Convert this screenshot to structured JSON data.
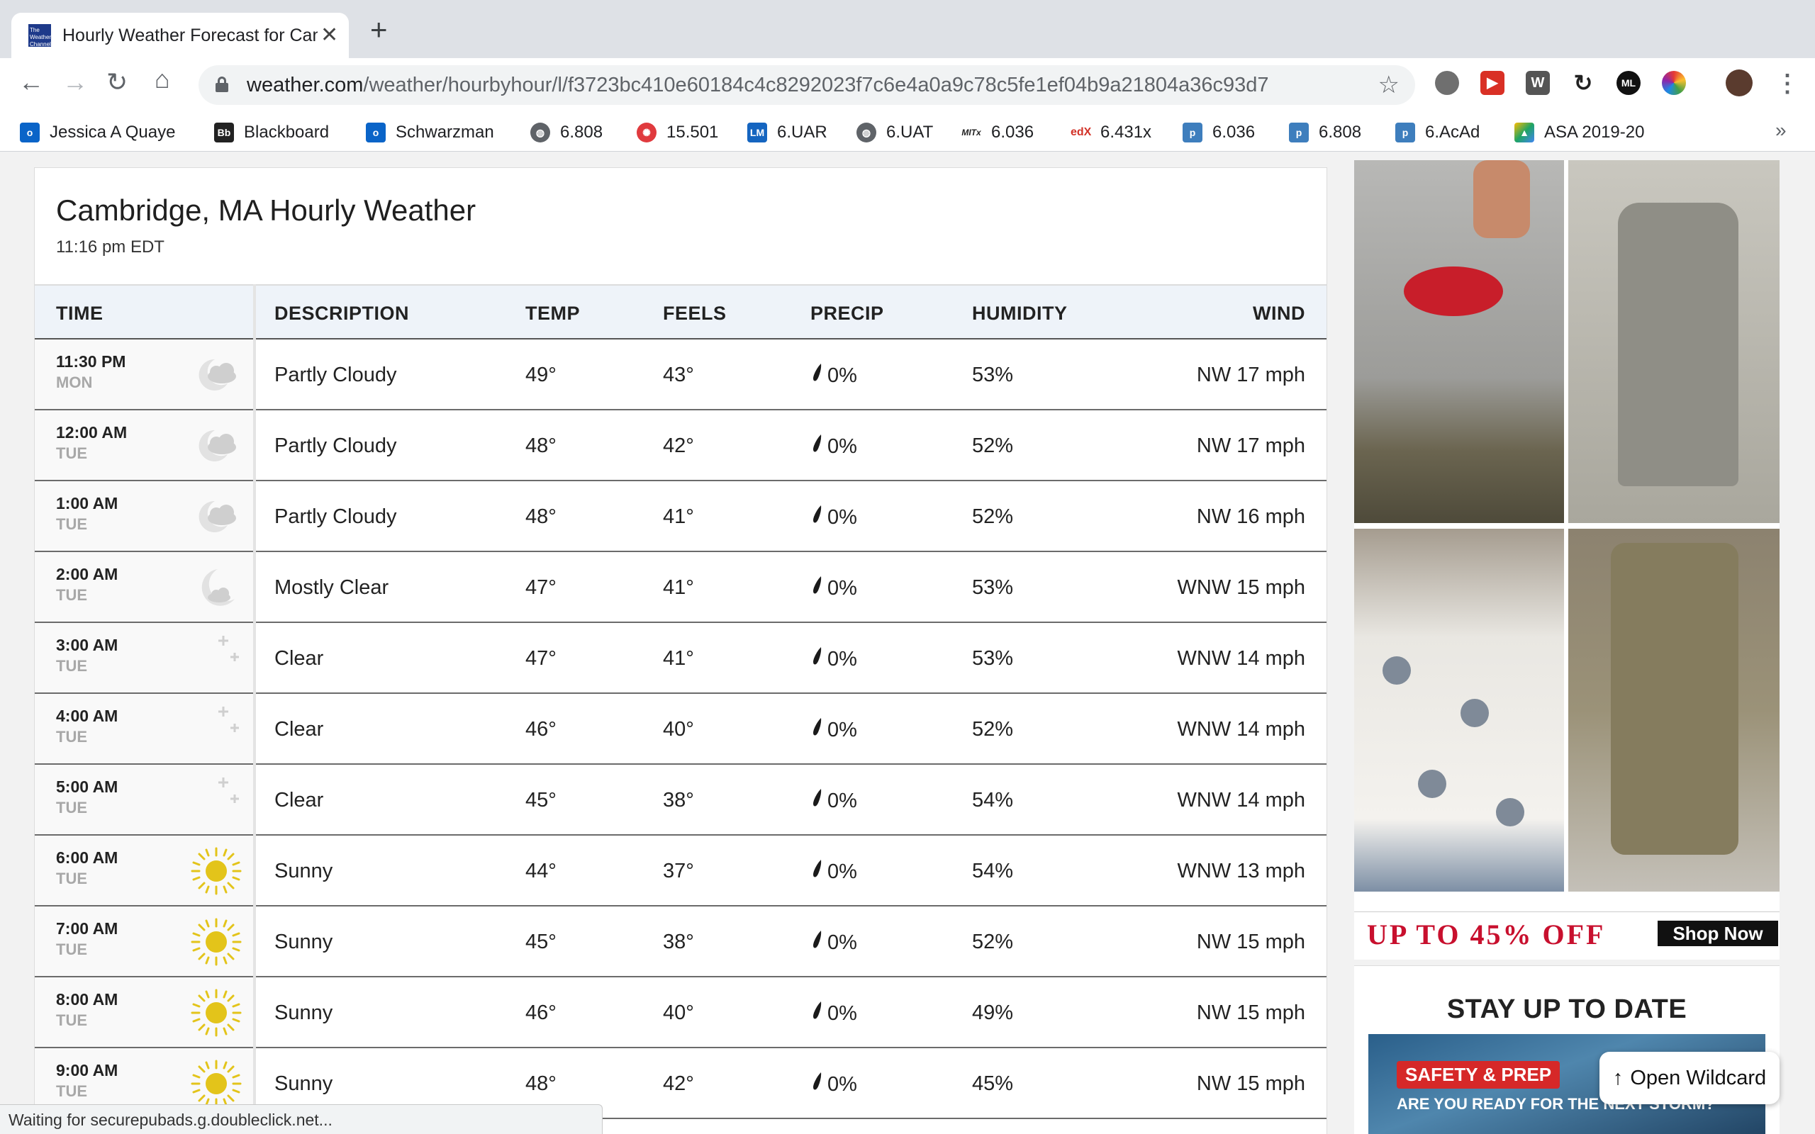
{
  "browser": {
    "tab_title": "Hourly Weather Forecast for Cambridge",
    "tab_favicon_text": "The Weather Channel",
    "url_host": "weather.com",
    "url_path": "/weather/hourbyhour/l/f3723bc410e60184c4c8292023f7c6e4a0a9c78c5fe1ef04b9a21804a36c93d7",
    "bookmarks": [
      {
        "label": "Jessica A Quaye",
        "icon": "outlook-icon",
        "color": "#0a64c8"
      },
      {
        "label": "Blackboard",
        "icon": "blackboard-icon",
        "color": "#222222"
      },
      {
        "label": "Schwarzman",
        "icon": "outlook-icon",
        "color": "#0a64c8"
      },
      {
        "label": "6.808",
        "icon": "globe-icon",
        "color": "#5f6368"
      },
      {
        "label": "15.501",
        "icon": "canvas-icon",
        "color": "#e03a3e"
      },
      {
        "label": "6.UAR",
        "icon": "lm-icon",
        "color": "#1565c0"
      },
      {
        "label": "6.UAT",
        "icon": "globe-icon",
        "color": "#5f6368"
      },
      {
        "label": "6.036",
        "icon": "mitx-icon",
        "color": "#333333"
      },
      {
        "label": "6.431x",
        "icon": "edx-icon",
        "color": "#d23228"
      },
      {
        "label": "6.036",
        "icon": "piazza-icon",
        "color": "#3e7ebd"
      },
      {
        "label": "6.808",
        "icon": "piazza-icon",
        "color": "#3e7ebd"
      },
      {
        "label": "6.AcAd",
        "icon": "piazza-icon",
        "color": "#3e7ebd"
      },
      {
        "label": "ASA 2019-20",
        "icon": "google-drive-icon",
        "color": "#1fa463"
      }
    ],
    "status_text": "Waiting for securepubads.g.doubleclick.net..."
  },
  "page": {
    "title": "Cambridge, MA Hourly Weather",
    "time": "11:16 pm EDT"
  },
  "table": {
    "headers": {
      "time": "TIME",
      "description": "DESCRIPTION",
      "temp": "TEMP",
      "feels": "FEELS",
      "precip": "PRECIP",
      "humidity": "HUMIDITY",
      "wind": "WIND"
    },
    "rows": [
      {
        "time": "11:30 PM",
        "day": "MON",
        "icon": "partly-cloudy-night-icon",
        "description": "Partly Cloudy",
        "temp": "49°",
        "feels": "43°",
        "precip": "0%",
        "humidity": "53%",
        "wind": "NW 17 mph"
      },
      {
        "time": "12:00 AM",
        "day": "TUE",
        "icon": "partly-cloudy-night-icon",
        "description": "Partly Cloudy",
        "temp": "48°",
        "feels": "42°",
        "precip": "0%",
        "humidity": "52%",
        "wind": "NW 17 mph"
      },
      {
        "time": "1:00 AM",
        "day": "TUE",
        "icon": "partly-cloudy-night-icon",
        "description": "Partly Cloudy",
        "temp": "48°",
        "feels": "41°",
        "precip": "0%",
        "humidity": "52%",
        "wind": "NW 16 mph"
      },
      {
        "time": "2:00 AM",
        "day": "TUE",
        "icon": "mostly-clear-night-icon",
        "description": "Mostly Clear",
        "temp": "47°",
        "feels": "41°",
        "precip": "0%",
        "humidity": "53%",
        "wind": "WNW 15 mph"
      },
      {
        "time": "3:00 AM",
        "day": "TUE",
        "icon": "clear-night-icon",
        "description": "Clear",
        "temp": "47°",
        "feels": "41°",
        "precip": "0%",
        "humidity": "53%",
        "wind": "WNW 14 mph"
      },
      {
        "time": "4:00 AM",
        "day": "TUE",
        "icon": "clear-night-icon",
        "description": "Clear",
        "temp": "46°",
        "feels": "40°",
        "precip": "0%",
        "humidity": "52%",
        "wind": "WNW 14 mph"
      },
      {
        "time": "5:00 AM",
        "day": "TUE",
        "icon": "clear-night-icon",
        "description": "Clear",
        "temp": "45°",
        "feels": "38°",
        "precip": "0%",
        "humidity": "54%",
        "wind": "WNW 14 mph"
      },
      {
        "time": "6:00 AM",
        "day": "TUE",
        "icon": "sun-icon",
        "description": "Sunny",
        "temp": "44°",
        "feels": "37°",
        "precip": "0%",
        "humidity": "54%",
        "wind": "WNW 13 mph"
      },
      {
        "time": "7:00 AM",
        "day": "TUE",
        "icon": "sun-icon",
        "description": "Sunny",
        "temp": "45°",
        "feels": "38°",
        "precip": "0%",
        "humidity": "52%",
        "wind": "NW 15 mph"
      },
      {
        "time": "8:00 AM",
        "day": "TUE",
        "icon": "sun-icon",
        "description": "Sunny",
        "temp": "46°",
        "feels": "40°",
        "precip": "0%",
        "humidity": "49%",
        "wind": "NW 15 mph"
      },
      {
        "time": "9:00 AM",
        "day": "TUE",
        "icon": "sun-icon",
        "description": "Sunny",
        "temp": "48°",
        "feels": "42°",
        "precip": "0%",
        "humidity": "45%",
        "wind": "NW 15 mph"
      }
    ]
  },
  "ad": {
    "promo": "UP TO 45% OFF",
    "cta": "Shop Now"
  },
  "sidebar": {
    "stay_title": "STAY UP TO DATE",
    "badge": "SAFETY & PREP",
    "question": "ARE YOU READY FOR THE NEXT STORM?"
  },
  "wildcard_label": "Open Wildcard",
  "colors": {
    "header_bg": "#eef3f9",
    "sun": "#e3c41a",
    "moon": "#d8d8d8",
    "promo_red": "#c8102e"
  }
}
